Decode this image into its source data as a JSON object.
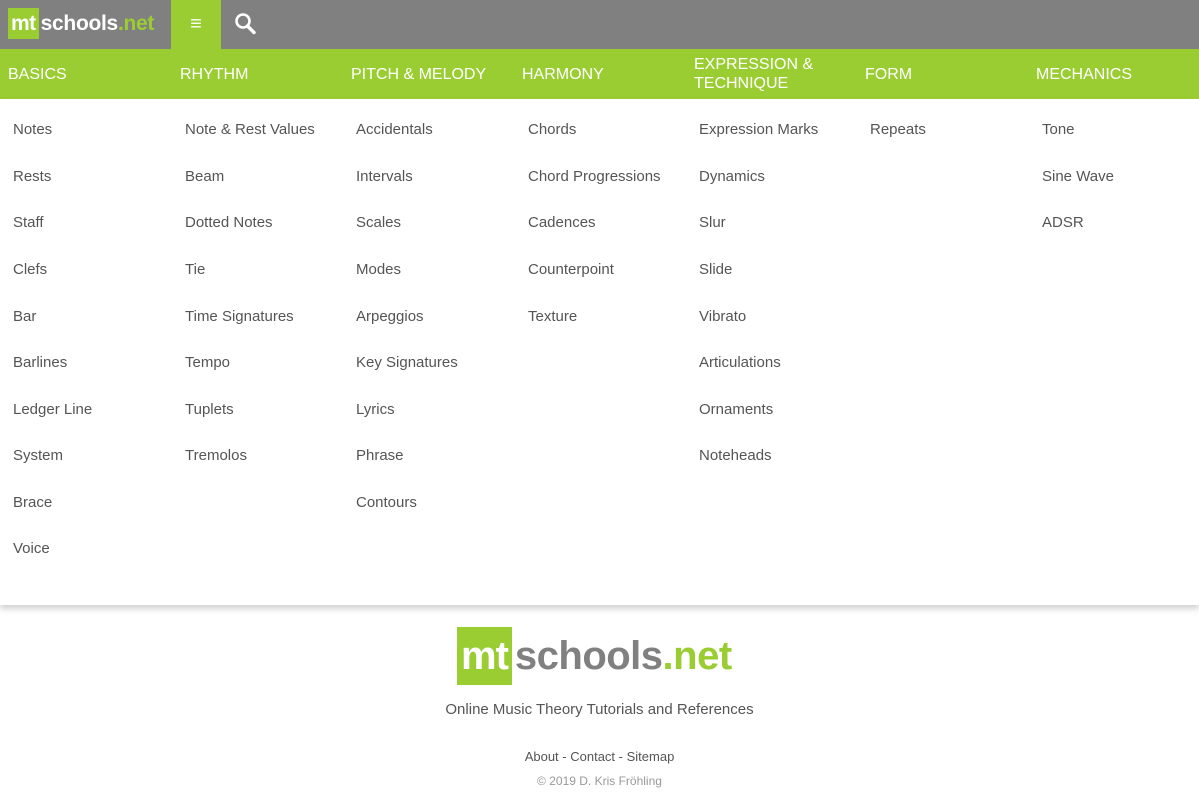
{
  "header": {
    "logo": {
      "mt": "mt",
      "schools": "schools",
      "net": ".net"
    },
    "menu_icon": "≡",
    "search_icon": "search-icon"
  },
  "colors": {
    "accent": "#9acd32",
    "topbar": "#808080",
    "text": "#555555"
  },
  "categories": [
    {
      "label": "Basics",
      "items": [
        "Notes",
        "Rests",
        "Staff",
        "Clefs",
        "Bar",
        "Barlines",
        "Ledger Line",
        "System",
        "Brace",
        "Voice"
      ]
    },
    {
      "label": "Rhythm",
      "items": [
        "Note & Rest Values",
        "Beam",
        "Dotted Notes",
        "Tie",
        "Time Signatures",
        "Tempo",
        "Tuplets",
        "Tremolos"
      ]
    },
    {
      "label": "Pitch & Melody",
      "items": [
        "Accidentals",
        "Intervals",
        "Scales",
        "Modes",
        "Arpeggios",
        "Key Signatures",
        "Lyrics",
        "Phrase",
        "Contours"
      ]
    },
    {
      "label": "Harmony",
      "items": [
        "Chords",
        "Chord Progressions",
        "Cadences",
        "Counterpoint",
        "Texture"
      ]
    },
    {
      "label": "Expression & Technique",
      "items": [
        "Expression Marks",
        "Dynamics",
        "Slur",
        "Slide",
        "Vibrato",
        "Articulations",
        "Ornaments",
        "Noteheads"
      ]
    },
    {
      "label": "Form",
      "items": [
        "Repeats"
      ]
    },
    {
      "label": "Mechanics",
      "items": [
        "Tone",
        "Sine Wave",
        "ADSR"
      ]
    }
  ],
  "footer": {
    "logo": {
      "mt": "mt",
      "schools": "schools",
      "net": ".net"
    },
    "tagline": "Online Music Theory Tutorials and References",
    "links": [
      "About",
      "Contact",
      "Sitemap"
    ],
    "separator": " - ",
    "copyright": "© 2019 D. Kris Fröhling"
  }
}
